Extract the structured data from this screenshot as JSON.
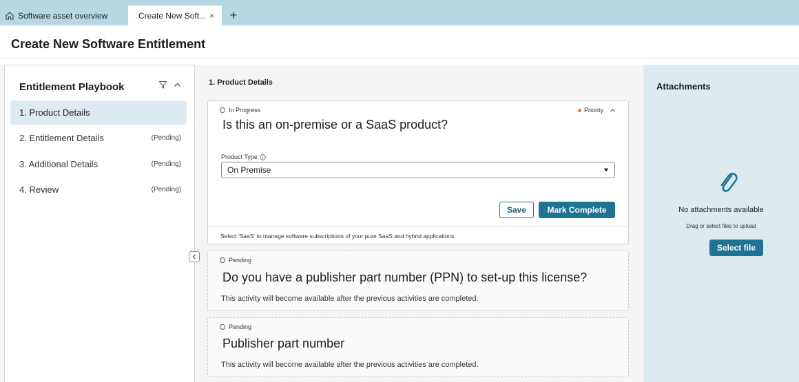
{
  "tabs": {
    "home_label": "Software asset overview",
    "active_label": "Create New Soft...",
    "close_symbol": "×",
    "add_symbol": "+"
  },
  "page": {
    "title": "Create New Software Entitlement"
  },
  "playbook": {
    "title": "Entitlement Playbook",
    "filter_icon": "filter-icon",
    "collapse_icon": "chevron-up-icon",
    "items": [
      {
        "label": "1. Product Details",
        "status": "",
        "active": true
      },
      {
        "label": "2. Entitlement Details",
        "status": "(Pending)",
        "active": false
      },
      {
        "label": "3. Additional Details",
        "status": "(Pending)",
        "active": false
      },
      {
        "label": "4. Review",
        "status": "(Pending)",
        "active": false
      }
    ]
  },
  "main": {
    "section_title": "1. Product Details",
    "active_card": {
      "status": "In Progress",
      "priority": "Priority",
      "question": "Is this an on-premise or a SaaS product?",
      "field_label": "Product Type",
      "field_value": "On Premise",
      "save_label": "Save",
      "complete_label": "Mark Complete",
      "footer": "Select 'SaaS' to manage software subscriptions of your pure SaaS and hybrid applications."
    },
    "pending_cards": [
      {
        "status": "Pending",
        "question": "Do you have a publisher part number (PPN) to set-up this license?",
        "note": "This activity will become available after the previous activities are completed."
      },
      {
        "status": "Pending",
        "question": "Publisher part number",
        "note": "This activity will become available after the previous activities are completed."
      }
    ]
  },
  "attachments": {
    "title": "Attachments",
    "empty_text": "No attachments available",
    "hint": "Drag or select files to upload",
    "button_label": "Select file",
    "icon": "paperclip-icon"
  },
  "colors": {
    "accent": "#1f7394",
    "tab_bar": "#b5d8e2",
    "panel_tint": "#ddeaf0",
    "priority": "#e07b1a"
  }
}
